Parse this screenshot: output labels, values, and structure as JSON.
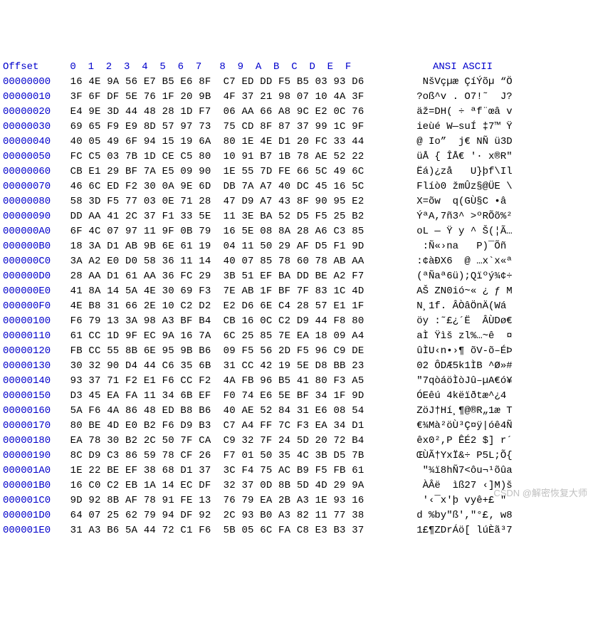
{
  "header": {
    "offset_label": "Offset",
    "columns": "0  1  2  3  4  5  6  7   8  9  A  B  C  D  E  F",
    "ascii_label": "ANSI ASCII"
  },
  "watermark": "CSDN @解密恢复大师",
  "rows": [
    {
      "offset": "00000000",
      "hex": "16 4E 9A 56 E7 B5 E6 8F  C7 ED DD F5 B5 03 93 D6",
      "ascii": " NšVçµæ ÇíÝõµ “Ö"
    },
    {
      "offset": "00000010",
      "hex": "3F 6F DF 5E 76 1F 20 9B  4F 37 21 98 07 10 4A 3F",
      "ascii": "?oß^v . O7!˜  J?"
    },
    {
      "offset": "00000020",
      "hex": "E4 9E 3D 44 48 28 1D F7  06 AA 66 A8 9C E2 0C 76",
      "ascii": "äž=DH( ÷ ªf¨œâ v"
    },
    {
      "offset": "00000030",
      "hex": "69 65 F9 E9 8D 57 97 73  75 CD 8F 87 37 99 1C 9F",
      "ascii": "ieùé W—suÍ ‡7™ Ÿ"
    },
    {
      "offset": "00000040",
      "hex": "40 05 49 6F 94 15 19 6A  80 1E 4E D1 20 FC 33 44",
      "ascii": "@ Io”  j€ NÑ ü3D"
    },
    {
      "offset": "00000050",
      "hex": "FC C5 03 7B 1D CE C5 80  10 91 B7 1B 78 AE 52 22",
      "ascii": "üÅ { ÎÅ€ '· x®R\""
    },
    {
      "offset": "00000060",
      "hex": "CB E1 29 BF 7A E5 09 90  1E 55 7D FE 66 5C 49 6C",
      "ascii": "Ëá)¿zå   U}þf\\Il"
    },
    {
      "offset": "00000070",
      "hex": "46 6C ED F2 30 0A 9E 6D  DB 7A A7 40 DC 45 16 5C",
      "ascii": "Flíò0 žmÛz§@ÜE \\"
    },
    {
      "offset": "00000080",
      "hex": "58 3D F5 77 03 0E 71 28  47 D9 A7 43 8F 90 95 E2",
      "ascii": "X=õw  q(GÙ§C •â"
    },
    {
      "offset": "00000090",
      "hex": "DD AA 41 2C 37 F1 33 5E  11 3E BA 52 D5 F5 25 B2",
      "ascii": "ÝªA,7ñ3^ >ºRÕõ%²"
    },
    {
      "offset": "000000A0",
      "hex": "6F 4C 07 97 11 9F 0B 79  16 5E 08 8A 28 A6 C3 85",
      "ascii": "oL — Ÿ y ^ Š(¦Ã…"
    },
    {
      "offset": "000000B0",
      "hex": "18 3A D1 AB 9B 6E 61 19  04 11 50 29 AF D5 F1 9D",
      "ascii": " :Ñ«›na   P)¯Õñ "
    },
    {
      "offset": "000000C0",
      "hex": "3A A2 E0 D0 58 36 11 14  40 07 85 78 60 78 AB AA",
      "ascii": ":¢àÐX6  @ …x`x«ª"
    },
    {
      "offset": "000000D0",
      "hex": "28 AA D1 61 AA 36 FC 29  3B 51 EF BA DD BE A2 F7",
      "ascii": "(ªÑaª6ü);Qïºý¾¢÷"
    },
    {
      "offset": "000000E0",
      "hex": "41 8A 14 5A 4E 30 69 F3  7E AB 1F BF 7F 83 1C 4D",
      "ascii": "AŠ ZN0ió~« ¿ ƒ M"
    },
    {
      "offset": "000000F0",
      "hex": "4E B8 31 66 2E 10 C2 D2  E2 D6 6E C4 28 57 E1 1F",
      "ascii": "N¸1f. ÂÒâÖnÄ(Wá "
    },
    {
      "offset": "00000100",
      "hex": "F6 79 13 3A 98 A3 BF B4  CB 16 0C C2 D9 44 F8 80",
      "ascii": "öy :˜£¿´Ë  ÂÙDø€"
    },
    {
      "offset": "00000110",
      "hex": "61 CC 1D 9F EC 9A 16 7A  6C 25 85 7E EA 18 09 A4",
      "ascii": "aÌ Ÿìš zl%…~ê  ¤"
    },
    {
      "offset": "00000120",
      "hex": "FB CC 55 8B 6E 95 9B B6  09 F5 56 2D F5 96 C9 DE",
      "ascii": "ûÌU‹n•›¶ õV-õ–ÉÞ"
    },
    {
      "offset": "00000130",
      "hex": "30 32 90 D4 44 C6 35 6B  31 CC 42 19 5E D8 BB 23",
      "ascii": "02 ÔDÆ5k1ÌB ^Ø»#"
    },
    {
      "offset": "00000140",
      "hex": "93 37 71 F2 E1 F6 CC F2  4A FB 96 B5 41 80 F3 A5",
      "ascii": "\"7qòáöÌòJû–µA€ó¥"
    },
    {
      "offset": "00000150",
      "hex": "D3 45 EA FA 11 34 6B EF  F0 74 E6 5E BF 34 1F 9D",
      "ascii": "ÓEêú 4këïðtæ^¿4 "
    },
    {
      "offset": "00000160",
      "hex": "5A F6 4A 86 48 ED B8 B6  40 AE 52 84 31 E6 08 54",
      "ascii": "ZöJ†Hí¸¶@®R„1æ T"
    },
    {
      "offset": "00000170",
      "hex": "80 BE 4D E0 B2 F6 D9 B3  C7 A4 FF 7C F3 EA 34 D1",
      "ascii": "€¾Mà²öÙ³Ç¤ÿ|óê4Ñ"
    },
    {
      "offset": "00000180",
      "hex": "EA 78 30 B2 2C 50 7F CA  C9 32 7F 24 5D 20 72 B4",
      "ascii": "êx0²,P ÊÉ2 $] r´"
    },
    {
      "offset": "00000190",
      "hex": "8C D9 C3 86 59 78 CF 26  F7 01 50 35 4C 3B D5 7B",
      "ascii": "ŒÙÃ†YxÏ&÷ P5L;Õ{"
    },
    {
      "offset": "000001A0",
      "hex": "1E 22 BE EF 38 68 D1 37  3C F4 75 AC B9 F5 FB 61",
      "ascii": " \"¾ï8hÑ7<ôu¬¹õûa"
    },
    {
      "offset": "000001B0",
      "hex": "16 C0 C2 EB 1A 14 EC DF  32 37 0D 8B 5D 4D 29 9A",
      "ascii": " ÀÂë  ìß27 ‹]M)š"
    },
    {
      "offset": "000001C0",
      "hex": "9D 92 8B AF 78 91 FE 13  76 79 EA 2B A3 1E 93 16",
      "ascii": " '‹¯x'þ vyê+£ \" "
    },
    {
      "offset": "000001D0",
      "hex": "64 07 25 62 79 94 DF 92  2C 93 B0 A3 82 11 77 38",
      "ascii": "d %by\"ß',\"°£‚ w8"
    },
    {
      "offset": "000001E0",
      "hex": "31 A3 B6 5A 44 72 C1 F6  5B 05 6C FA C8 E3 B3 37",
      "ascii": "1£¶ZDrÁö[ lúÈã³7"
    }
  ]
}
